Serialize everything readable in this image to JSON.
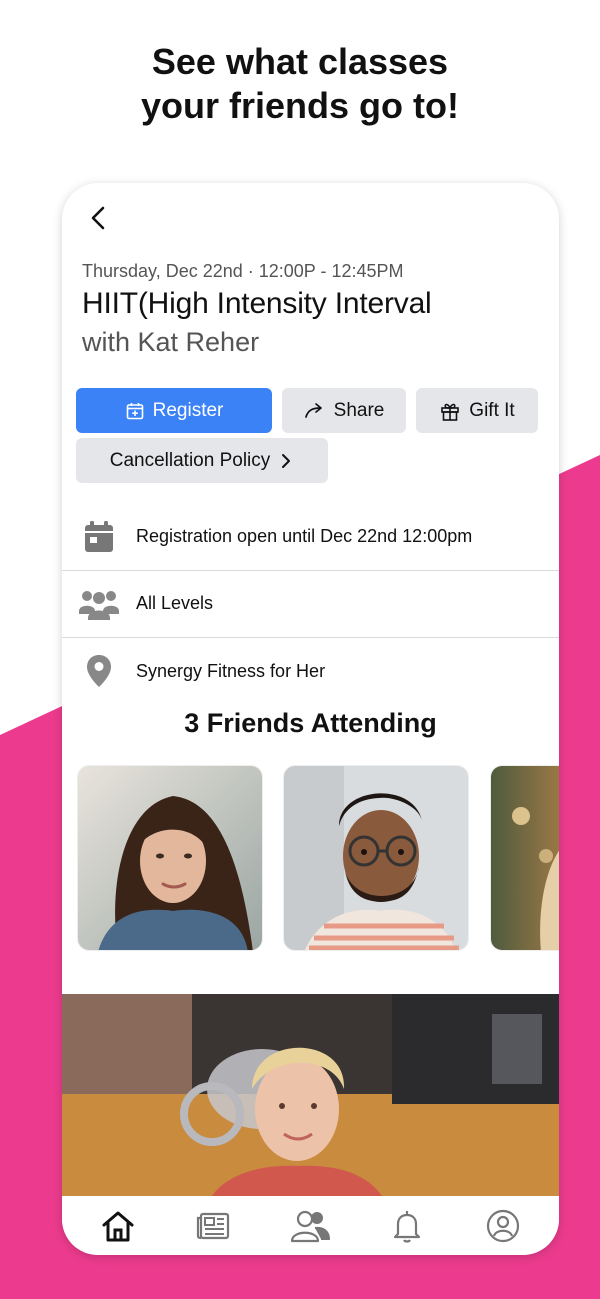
{
  "headline": {
    "line1": "See what classes",
    "line2": "your friends go to!"
  },
  "colors": {
    "accent_pink": "#ec3b8e",
    "primary_blue": "#3b82f6",
    "button_gray": "#e4e6e9"
  },
  "class_detail": {
    "datetime": "Thursday, Dec 22nd · 12:00P - 12:45PM",
    "title": "HIIT(High Intensity Interval",
    "instructor": "with Kat Reher"
  },
  "actions": {
    "register_label": "Register",
    "share_label": "Share",
    "gift_label": "Gift It",
    "policy_label": "Cancellation Policy"
  },
  "info": [
    {
      "icon": "calendar-icon",
      "text": "Registration open until Dec 22nd 12:00pm"
    },
    {
      "icon": "group-icon",
      "text": "All Levels"
    },
    {
      "icon": "location-pin-icon",
      "text": "Synergy Fitness for Her"
    }
  ],
  "friends": {
    "title": "3 Friends Attending",
    "avatars": [
      "friend-photo-woman-brunette",
      "friend-photo-man-glasses",
      "friend-photo-woman-blonde"
    ]
  },
  "tabbar": [
    {
      "icon": "home-icon",
      "active": true
    },
    {
      "icon": "news-icon",
      "active": false
    },
    {
      "icon": "people-icon",
      "active": false
    },
    {
      "icon": "bell-icon",
      "active": false
    },
    {
      "icon": "profile-icon",
      "active": false
    }
  ]
}
